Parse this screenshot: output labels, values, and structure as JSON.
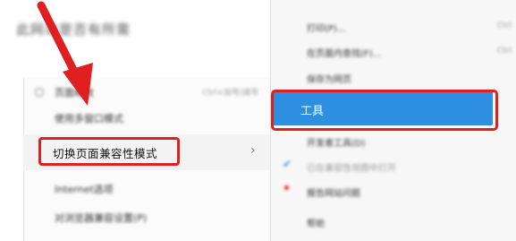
{
  "background_window": {
    "title": "此网站是否有所需"
  },
  "left_menu": {
    "items": [
      {
        "label": "页面缩放",
        "shortcut": "Ctrl+加号/减号"
      },
      {
        "label": "使用多窗口模式",
        "shortcut": ""
      },
      {
        "label": "切换页面兼容性模式",
        "shortcut": ""
      },
      {
        "label": "Internet选项",
        "shortcut": ""
      },
      {
        "label": "对浏览器兼容设置(P)",
        "shortcut": ""
      }
    ],
    "highlighted_index": 2
  },
  "right_menu": {
    "items": [
      {
        "label": "打印(P)...",
        "shortcut": "Ctrl"
      },
      {
        "label": "在页面内查找(F)...",
        "shortcut": "Ctrl"
      },
      {
        "label": "保存为网页",
        "shortcut": ""
      },
      {
        "label": "工具",
        "shortcut": ""
      },
      {
        "label": "开发者工具(D)",
        "shortcut": ""
      },
      {
        "label": "已在兼容性视图中打开",
        "shortcut": ""
      },
      {
        "label": "报告网站问题",
        "shortcut": ""
      },
      {
        "label": "帮助",
        "shortcut": ""
      }
    ],
    "selected_index": 3
  },
  "colors": {
    "highlight_border": "#e02020",
    "selected_bg": "#2e8fe0",
    "arrow": "#e02020"
  },
  "icons": {
    "submenu_chevron": "chevron-right-icon",
    "checkmark": "check-icon",
    "bullet": "red-dot-icon"
  }
}
